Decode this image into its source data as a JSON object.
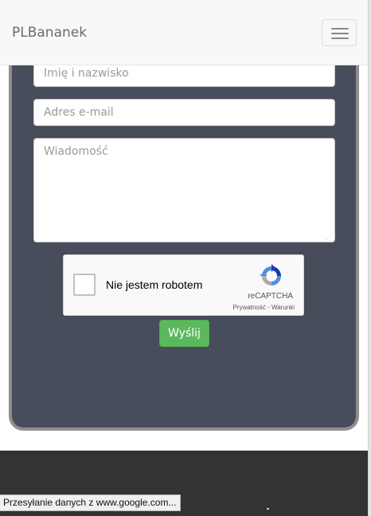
{
  "navbar": {
    "brand": "PLBananek",
    "toggle_icon": "hamburger-icon"
  },
  "form": {
    "name_placeholder": "Imię i nazwisko",
    "name_value": "",
    "email_placeholder": "Adres e-mail",
    "email_value": "",
    "message_placeholder": "Wiadomość",
    "message_value": "",
    "submit_label": "Wyślij",
    "submit_color": "#5cb85c",
    "panel_color": "#474d5a"
  },
  "captcha": {
    "label": "Nie jestem robotem",
    "checked": false,
    "brand": "reCAPTCHA",
    "links": "Prywatność - Warunki",
    "logo_icon": "recaptcha-logo-icon"
  },
  "footer": {
    "background": "#333333"
  },
  "statusbar": {
    "text": "Przesyłanie danych z www.google.com..."
  }
}
